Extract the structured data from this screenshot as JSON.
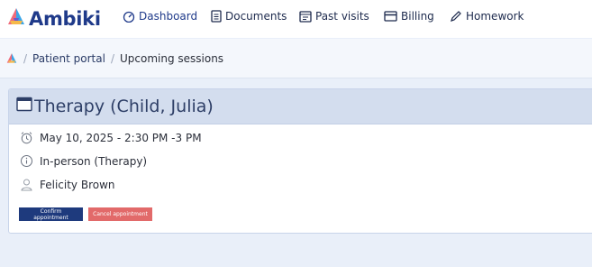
{
  "brand": {
    "name": "Ambiki"
  },
  "nav": [
    {
      "label": "Dashboard",
      "icon": "dashboard-icon"
    },
    {
      "label": "Documents",
      "icon": "document-icon"
    },
    {
      "label": "Past visits",
      "icon": "calendar-list-icon"
    },
    {
      "label": "Billing",
      "icon": "credit-card-icon"
    },
    {
      "label": "Homework",
      "icon": "pencil-icon"
    }
  ],
  "breadcrumb": {
    "separator": "/",
    "items": [
      {
        "label": "Patient portal"
      },
      {
        "label": "Upcoming sessions"
      }
    ]
  },
  "session": {
    "title": "Therapy (Child, Julia)",
    "datetime": "May 10, 2025 - 2:30 PM -3 PM",
    "location": "In-person (Therapy)",
    "provider": "Felicity Brown",
    "confirm_label": "Confirm appointment",
    "cancel_label": "Cancel appointment"
  },
  "colors": {
    "primary": "#1e3a7d",
    "danger": "#e26a6a",
    "card_header": "#d3ddee",
    "background": "#e9eff9"
  }
}
